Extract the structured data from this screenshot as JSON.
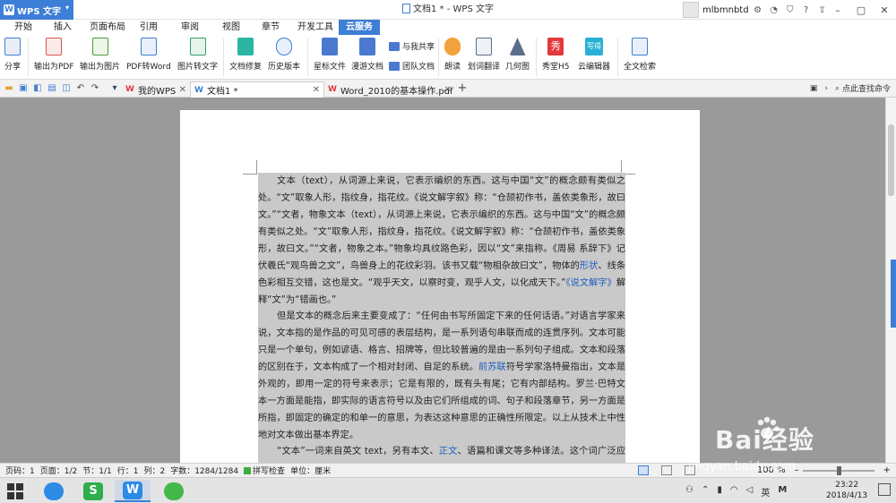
{
  "titlebar": {
    "app_name": "WPS 文字",
    "window_title": "文档1 * - WPS 文字",
    "username": "mlbmnbtd",
    "icons": [
      "user-avatar",
      "message-icon",
      "shirt-icon",
      "help-icon",
      "upload-icon"
    ],
    "window_controls": [
      "minimize",
      "restore",
      "close"
    ]
  },
  "menu": {
    "tabs": [
      "开始",
      "插入",
      "页面布局",
      "引用",
      "审阅",
      "视图",
      "章节",
      "开发工具",
      "云服务"
    ],
    "active_tab": "云服务"
  },
  "ribbon": {
    "buttons": [
      {
        "label": "分享",
        "icon": "share-icon"
      },
      {
        "label": "输出为PDF",
        "icon": "export-pdf-icon"
      },
      {
        "label": "输出为图片",
        "icon": "export-image-icon"
      },
      {
        "label": "PDF转Word",
        "icon": "pdf-to-word-icon"
      },
      {
        "label": "图片转文字",
        "icon": "image-to-text-icon"
      },
      {
        "label": "文档修复",
        "icon": "doc-repair-icon"
      },
      {
        "label": "历史版本",
        "icon": "history-icon"
      },
      {
        "label": "星标文件",
        "icon": "star-file-icon"
      },
      {
        "label": "漫游文档",
        "icon": "roaming-doc-icon"
      },
      {
        "label": "朗读",
        "icon": "read-aloud-icon"
      },
      {
        "label": "划词翻译",
        "icon": "translate-icon"
      },
      {
        "label": "几何图",
        "icon": "geometry-icon"
      },
      {
        "label": "秀堂H5",
        "icon": "xiutang-icon"
      },
      {
        "label": "云编辑器",
        "icon": "cloud-editor-icon"
      },
      {
        "label": "全文检索",
        "icon": "fulltext-search-icon"
      }
    ],
    "small_buttons": [
      {
        "label": "与我共享",
        "icon": "shared-with-me-icon"
      },
      {
        "label": "团队文档",
        "icon": "team-doc-icon"
      }
    ],
    "badge_text": "秀",
    "cloud_editor_badge": "写得"
  },
  "doc_tabs": {
    "tabs": [
      {
        "label": "我的WPS",
        "icon": "W"
      },
      {
        "label": "文档1 *",
        "icon": "W"
      },
      {
        "label": "Word_2010的基本操作.pdf",
        "icon": "W"
      }
    ],
    "new_tab": "+",
    "find_command": "点此查找命令"
  },
  "document": {
    "para1": [
      "文本（text），从词源上来说，它表示编织的东西。这与中国“文”的概念颇有类似之处。“文”取象人形，指纹身，指花纹。《说文解字叙》称：“仓颉初作书，盖依类象形，故曰文。”“文者，物象文本（text），从词源上来说，它表示编织的东西。这与中国“文”的概念颇有类似之处。“文”取象人形，指纹身，指花纹。《说文解字叙》称：“仓颉初作书，盖依类象形，故曰文。”“文者，物象之本。”物象均具纹路色彩，因以“文”来指称。《周易 系辞下》记伏羲氏“观鸟兽之文”，鸟兽身上的花纹彩羽。该书又载“物相杂故曰文”，物体的",
      "形状",
      "、线条色彩相互交错，这也是文。“观乎天文，以察时变，观乎人文，以化成天下。”",
      "《说文解字》",
      "解释“文”为“错画也。”"
    ],
    "para2": [
      "但是文本的概念后来主要变成了：“任何由书写所固定下来的任何话语。”对语言学家来说，文本指的是作品的可见可感的表层结构，是一系列语句串联而成的连贯序列。文本可能只是一个单句，例如谚语、格言、招牌等，但比较普遍的是由一系列句子组成。文本和段落的区别在于，文本构成了一个相对封闭、自足的系统。",
      "前苏联",
      "符号学家洛特曼指出，文本是外观的，即用一定的符号来表示；它是有限的，既有头有尾；它有内部结构。罗兰·巴特文本一方面是能指，即实际的语言符号以及由它们所组成的词、句子和段落章节，另一方面是所指，即固定的确定的和单一的意思，为表达这种意思的正确性所限定。以上从技术上中性地对文本做出基本界定。"
    ],
    "para3": [
      "“文本”一词来自英文 text，另有本文、",
      "正文",
      "、语篇和课文等多种译法。这个词广泛应用"
    ]
  },
  "statusbar": {
    "page": "页码：1",
    "pages": "页面：1/2",
    "section": "节：1/1",
    "row": "行：1",
    "column": "列：2",
    "wordcount": "字数：1284/1284",
    "spellcheck": "拼写检查",
    "unit": "单位：厘米",
    "zoom": "100 %"
  },
  "taskbar": {
    "apps": [
      "windows-start",
      "browser-app",
      "wps-spreadsheet-app",
      "wps-writer-app",
      "wechat-app"
    ],
    "tray_input": "英",
    "tray_ime": "M",
    "time": "23:22",
    "date": "2018/4/13"
  },
  "watermark": {
    "brand": "Bai经验",
    "url": "jingyan.baidu.com"
  }
}
